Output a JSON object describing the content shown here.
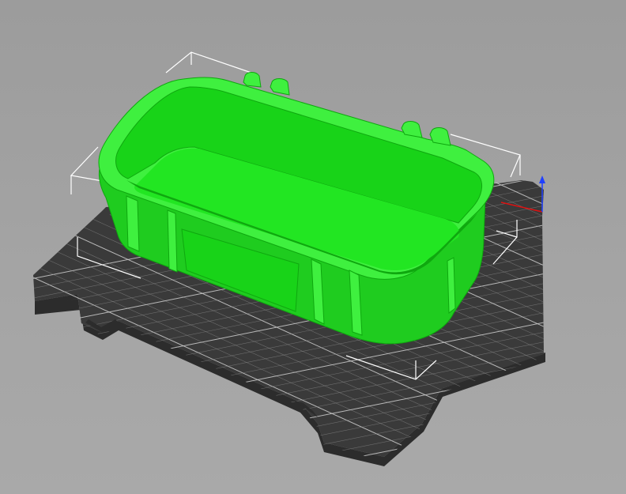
{
  "viewport": {
    "background_top": "#9c9c9c",
    "background_bottom": "#a9a9a9"
  },
  "bed": {
    "plate_color": "#3a3a3a",
    "edge_color": "#2c2c2c",
    "grid_color": "#8e8e8e",
    "grid_major_color": "#c8c8c8"
  },
  "model": {
    "color": "#18d318",
    "wall_color": "#1fcc1f",
    "rim_color": "#3ff03f",
    "shade_color": "#0fa80f",
    "floor_color": "#22e622"
  },
  "bounding_box": {
    "color": "#ffffff"
  },
  "axes": {
    "x_color": "#e01010",
    "y_color": "#10c010",
    "z_color": "#2040ff"
  }
}
